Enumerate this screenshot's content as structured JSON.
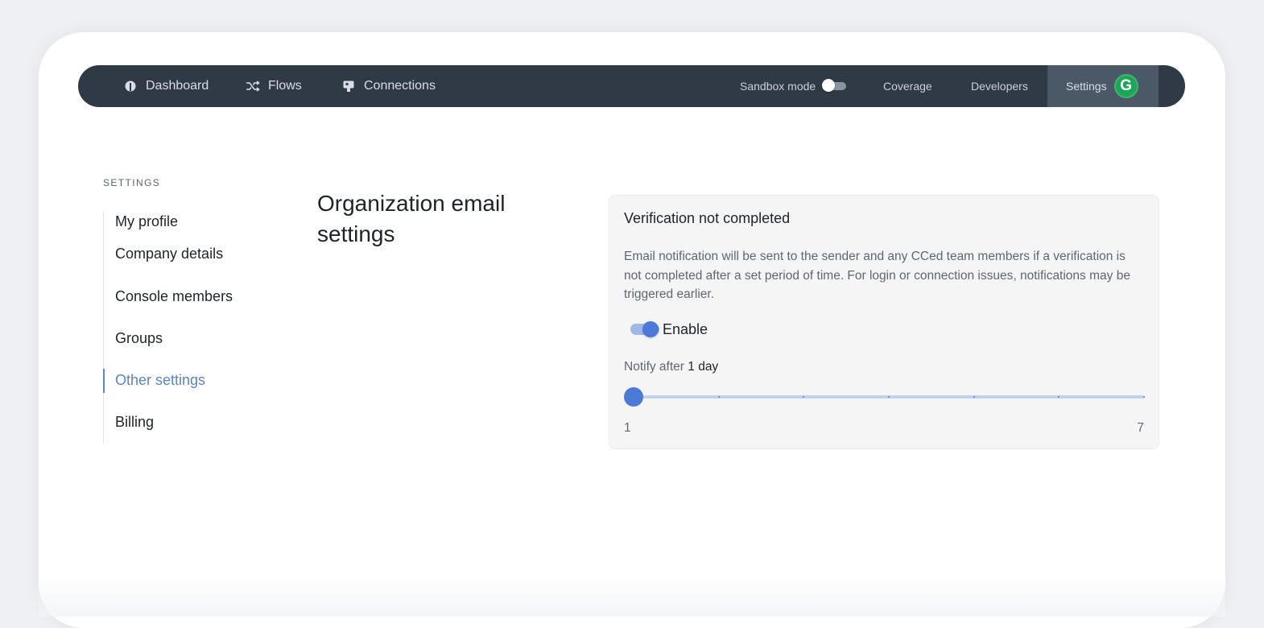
{
  "nav": {
    "left": [
      {
        "label": "Dashboard",
        "icon": "dashboard-icon"
      },
      {
        "label": "Flows",
        "icon": "shuffle-icon"
      },
      {
        "label": "Connections",
        "icon": "connections-icon"
      }
    ],
    "sandbox_label": "Sandbox mode",
    "sandbox_enabled": false,
    "coverage_label": "Coverage",
    "developers_label": "Developers",
    "settings_label": "Settings",
    "avatar_letter": "G",
    "colors": {
      "bar": "#2f3a46",
      "active_tab": "#4b5866",
      "avatar": "#1fa55a"
    }
  },
  "sidebar": {
    "heading": "SETTINGS",
    "items": [
      {
        "label": "My profile",
        "active": false
      },
      {
        "label": "Company details",
        "active": false
      },
      {
        "label": "Console members",
        "active": false
      },
      {
        "label": "Groups",
        "active": false
      },
      {
        "label": "Other settings",
        "active": true
      },
      {
        "label": "Billing",
        "active": false
      }
    ],
    "active_color": "#5b84c4"
  },
  "main": {
    "title": "Organization email settings",
    "panel": {
      "title": "Verification not completed",
      "description": "Email notification will be sent to the sender and any CCed team members if a verification is not completed after a set period of time. For login or connection issues, notifications may be triggered earlier.",
      "enable_label": "Enable",
      "enabled": true,
      "notify_prefix": "Notify after",
      "notify_value": "1 day",
      "slider": {
        "min": 1,
        "max": 7,
        "value": 1,
        "min_label": "1",
        "max_label": "7"
      },
      "accent": "#4d79d8"
    }
  }
}
